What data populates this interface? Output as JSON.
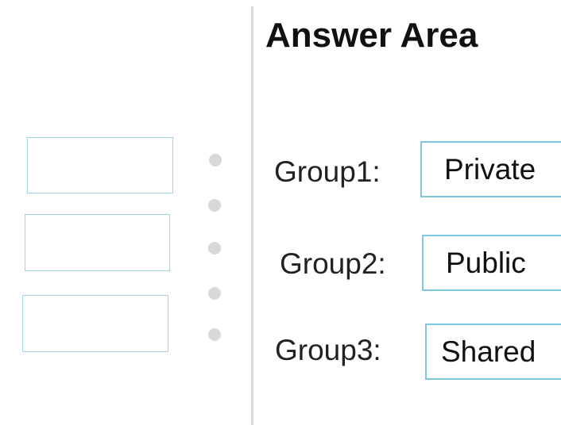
{
  "answer_area": {
    "title": "Answer Area",
    "rows": [
      {
        "label": "Group1:",
        "answer": "Private"
      },
      {
        "label": "Group2:",
        "answer": "Public"
      },
      {
        "label": "Group3:",
        "answer": "Shared"
      }
    ]
  },
  "colors": {
    "box_border": "#7ec6df",
    "divider": "#d9d9d9",
    "handle_dot": "#d8d8d8"
  }
}
